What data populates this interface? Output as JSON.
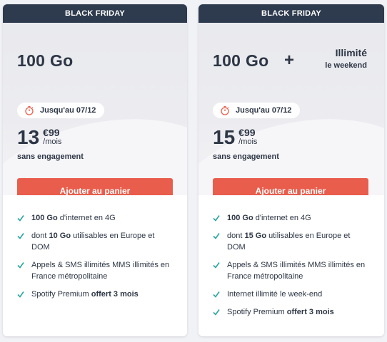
{
  "offers": [
    {
      "banner": "BLACK FRIDAY",
      "data": "100 Go",
      "deadline": "Jusqu'au 07/12",
      "price_euros": "13",
      "price_cents": "€99",
      "price_period": "/mois",
      "commitment": "sans engagement",
      "cta": "Ajouter au panier",
      "features": [
        {
          "pre": "",
          "bold": "100 Go",
          "post": " d'internet en 4G"
        },
        {
          "pre": "dont ",
          "bold": "10 Go",
          "post": " utilisables en Europe et DOM"
        },
        {
          "pre": "Appels & SMS illimités MMS illimités en France métropolitaine",
          "bold": "",
          "post": ""
        },
        {
          "pre": "Spotify Premium ",
          "bold": "offert 3 mois",
          "post": ""
        }
      ]
    },
    {
      "banner": "BLACK FRIDAY",
      "data": "100 Go",
      "plus": "+",
      "weekend_line1": "Illimité",
      "weekend_line2": "le weekend",
      "deadline": "Jusqu'au 07/12",
      "price_euros": "15",
      "price_cents": "€99",
      "price_period": "/mois",
      "commitment": "sans engagement",
      "cta": "Ajouter au panier",
      "features": [
        {
          "pre": "",
          "bold": "100 Go",
          "post": " d'internet en 4G"
        },
        {
          "pre": "dont ",
          "bold": "15 Go",
          "post": " utilisables en Europe et DOM"
        },
        {
          "pre": "Appels & SMS illimités MMS illimités en France métropolitaine",
          "bold": "",
          "post": ""
        },
        {
          "pre": "Internet illimité le week-end",
          "bold": "",
          "post": ""
        },
        {
          "pre": "Spotify Premium ",
          "bold": "offert 3 mois",
          "post": ""
        }
      ]
    }
  ],
  "colors": {
    "banner_bg": "#2e3b4e",
    "cta_bg": "#e95d4c",
    "check": "#2aa6a0",
    "text": "#2d3645"
  },
  "icons": {
    "deadline": "stopwatch-icon",
    "feature": "check-icon"
  }
}
